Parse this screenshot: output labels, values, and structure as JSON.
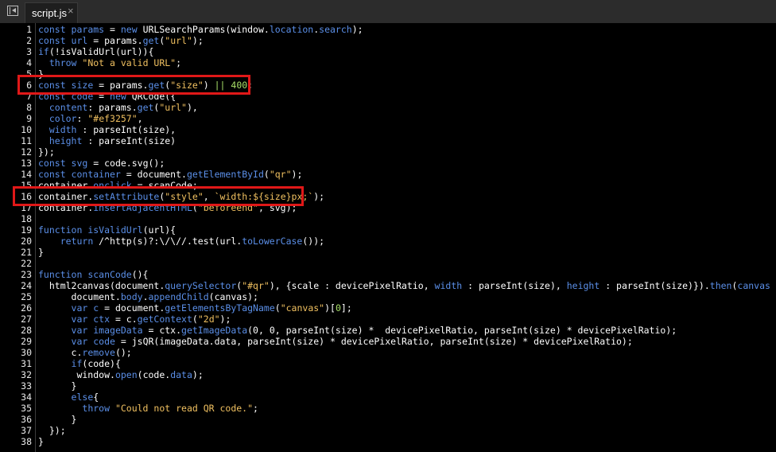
{
  "tab": {
    "label": "script.js",
    "close": "×"
  },
  "lines": [
    {
      "n": "1",
      "tokens": [
        [
          "kw",
          "const "
        ],
        [
          "id",
          "params"
        ],
        [
          "tx",
          " = "
        ],
        [
          "kw",
          "new "
        ],
        [
          "tx",
          "URLSearchParams(window."
        ],
        [
          "id",
          "location"
        ],
        [
          "tx",
          "."
        ],
        [
          "id",
          "search"
        ],
        [
          "tx",
          ");"
        ]
      ]
    },
    {
      "n": "2",
      "tokens": [
        [
          "kw",
          "const "
        ],
        [
          "id",
          "url"
        ],
        [
          "tx",
          " = params."
        ],
        [
          "id",
          "get"
        ],
        [
          "tx",
          "("
        ],
        [
          "str",
          "\"url\""
        ],
        [
          "tx",
          ");"
        ]
      ]
    },
    {
      "n": "3",
      "tokens": [
        [
          "kw",
          "if"
        ],
        [
          "tx",
          "(!isValidUrl(url)){"
        ]
      ]
    },
    {
      "n": "4",
      "tokens": [
        [
          "tx",
          "  "
        ],
        [
          "kw",
          "throw "
        ],
        [
          "str",
          "\"Not a valid URL\""
        ],
        [
          "tx",
          ";"
        ]
      ]
    },
    {
      "n": "5",
      "tokens": [
        [
          "tx",
          "}"
        ]
      ]
    },
    {
      "n": "6",
      "tokens": [
        [
          "kw",
          "const "
        ],
        [
          "id",
          "size"
        ],
        [
          "tx",
          " = params."
        ],
        [
          "id",
          "get"
        ],
        [
          "tx",
          "("
        ],
        [
          "str",
          "\"size\""
        ],
        [
          "tx",
          ") "
        ],
        [
          "num",
          "|| 400"
        ],
        [
          "tx",
          ";"
        ]
      ]
    },
    {
      "n": "7",
      "tokens": [
        [
          "kw",
          "const "
        ],
        [
          "id",
          "code"
        ],
        [
          "tx",
          " = "
        ],
        [
          "kw",
          "new "
        ],
        [
          "tx",
          "QRCode({"
        ]
      ]
    },
    {
      "n": "8",
      "tokens": [
        [
          "tx",
          "  "
        ],
        [
          "id",
          "content"
        ],
        [
          "tx",
          ": params."
        ],
        [
          "id",
          "get"
        ],
        [
          "tx",
          "("
        ],
        [
          "str",
          "\"url\""
        ],
        [
          "tx",
          "),"
        ]
      ]
    },
    {
      "n": "9",
      "tokens": [
        [
          "tx",
          "  "
        ],
        [
          "id",
          "color"
        ],
        [
          "tx",
          ": "
        ],
        [
          "str",
          "\"#ef3257\""
        ],
        [
          "tx",
          ","
        ]
      ]
    },
    {
      "n": "10",
      "tokens": [
        [
          "tx",
          "  "
        ],
        [
          "id",
          "width"
        ],
        [
          "tx",
          " : parseInt(size),"
        ]
      ]
    },
    {
      "n": "11",
      "tokens": [
        [
          "tx",
          "  "
        ],
        [
          "id",
          "height"
        ],
        [
          "tx",
          " : parseInt(size)"
        ]
      ]
    },
    {
      "n": "12",
      "tokens": [
        [
          "tx",
          "});"
        ]
      ]
    },
    {
      "n": "13",
      "tokens": [
        [
          "kw",
          "const "
        ],
        [
          "id",
          "svg"
        ],
        [
          "tx",
          " = code.svg();"
        ]
      ]
    },
    {
      "n": "14",
      "tokens": [
        [
          "kw",
          "const "
        ],
        [
          "id",
          "container"
        ],
        [
          "tx",
          " = document."
        ],
        [
          "id",
          "getElementById"
        ],
        [
          "tx",
          "("
        ],
        [
          "str",
          "\"qr\""
        ],
        [
          "tx",
          ");"
        ]
      ]
    },
    {
      "n": "15",
      "tokens": [
        [
          "tx",
          "container."
        ],
        [
          "id",
          "onclick"
        ],
        [
          "tx",
          " = scanCode;"
        ]
      ]
    },
    {
      "n": "16",
      "tokens": [
        [
          "tx",
          "container."
        ],
        [
          "id",
          "setAttribute"
        ],
        [
          "tx",
          "("
        ],
        [
          "str",
          "\"style\""
        ],
        [
          "tx",
          ", "
        ],
        [
          "str",
          "`width:${size}px;`"
        ],
        [
          "tx",
          ");"
        ]
      ]
    },
    {
      "n": "17",
      "tokens": [
        [
          "tx",
          "container."
        ],
        [
          "id",
          "insertAdjacentHTML"
        ],
        [
          "tx",
          "("
        ],
        [
          "str",
          "\"beforeend\""
        ],
        [
          "tx",
          ", svg);"
        ]
      ]
    },
    {
      "n": "18",
      "tokens": []
    },
    {
      "n": "19",
      "tokens": [
        [
          "kw",
          "function "
        ],
        [
          "id",
          "isValidUrl"
        ],
        [
          "tx",
          "(url){"
        ]
      ]
    },
    {
      "n": "20",
      "tokens": [
        [
          "tx",
          "    "
        ],
        [
          "kw",
          "return "
        ],
        [
          "tx",
          "/^http(s)?:\\/\\//.test(url."
        ],
        [
          "id",
          "toLowerCase"
        ],
        [
          "tx",
          "());"
        ]
      ]
    },
    {
      "n": "21",
      "tokens": [
        [
          "tx",
          "}"
        ]
      ]
    },
    {
      "n": "22",
      "tokens": []
    },
    {
      "n": "23",
      "tokens": [
        [
          "kw",
          "function "
        ],
        [
          "id",
          "scanCode"
        ],
        [
          "tx",
          "(){"
        ]
      ]
    },
    {
      "n": "24",
      "tokens": [
        [
          "tx",
          "  html2canvas(document."
        ],
        [
          "id",
          "querySelector"
        ],
        [
          "tx",
          "("
        ],
        [
          "str",
          "\"#qr\""
        ],
        [
          "tx",
          "), {scale : devicePixelRatio, "
        ],
        [
          "id",
          "width"
        ],
        [
          "tx",
          " : parseInt(size), "
        ],
        [
          "id",
          "height"
        ],
        [
          "tx",
          " : parseInt(size)})."
        ],
        [
          "id",
          "then"
        ],
        [
          "tx",
          "("
        ],
        [
          "id",
          "canvas"
        ],
        [
          "kw",
          " => "
        ],
        [
          "tx",
          "{"
        ]
      ]
    },
    {
      "n": "25",
      "tokens": [
        [
          "tx",
          "      document."
        ],
        [
          "id",
          "body"
        ],
        [
          "tx",
          "."
        ],
        [
          "id",
          "appendChild"
        ],
        [
          "tx",
          "(canvas);"
        ]
      ]
    },
    {
      "n": "26",
      "tokens": [
        [
          "tx",
          "      "
        ],
        [
          "kw",
          "var "
        ],
        [
          "id",
          "c"
        ],
        [
          "tx",
          " = document."
        ],
        [
          "id",
          "getElementsByTagName"
        ],
        [
          "tx",
          "("
        ],
        [
          "str",
          "\"canvas\""
        ],
        [
          "tx",
          ")["
        ],
        [
          "num",
          "0"
        ],
        [
          "tx",
          "];"
        ]
      ]
    },
    {
      "n": "27",
      "tokens": [
        [
          "tx",
          "      "
        ],
        [
          "kw",
          "var "
        ],
        [
          "id",
          "ctx"
        ],
        [
          "tx",
          " = c."
        ],
        [
          "id",
          "getContext"
        ],
        [
          "tx",
          "("
        ],
        [
          "str",
          "\"2d\""
        ],
        [
          "tx",
          ");"
        ]
      ]
    },
    {
      "n": "28",
      "tokens": [
        [
          "tx",
          "      "
        ],
        [
          "kw",
          "var "
        ],
        [
          "id",
          "imageData"
        ],
        [
          "tx",
          " = ctx."
        ],
        [
          "id",
          "getImageData"
        ],
        [
          "tx",
          "(0, 0, parseInt(size) *  devicePixelRatio, parseInt(size) * devicePixelRatio);"
        ]
      ]
    },
    {
      "n": "29",
      "tokens": [
        [
          "tx",
          "      "
        ],
        [
          "kw",
          "var "
        ],
        [
          "id",
          "code"
        ],
        [
          "tx",
          " = jsQR(imageData.data, parseInt(size) * devicePixelRatio, parseInt(size) * devicePixelRatio);"
        ]
      ]
    },
    {
      "n": "30",
      "tokens": [
        [
          "tx",
          "      c."
        ],
        [
          "id",
          "remove"
        ],
        [
          "tx",
          "();"
        ]
      ]
    },
    {
      "n": "31",
      "tokens": [
        [
          "tx",
          "      "
        ],
        [
          "kw",
          "if"
        ],
        [
          "tx",
          "(code){"
        ]
      ]
    },
    {
      "n": "32",
      "tokens": [
        [
          "tx",
          "       window."
        ],
        [
          "id",
          "open"
        ],
        [
          "tx",
          "(code."
        ],
        [
          "id",
          "data"
        ],
        [
          "tx",
          ");"
        ]
      ]
    },
    {
      "n": "33",
      "tokens": [
        [
          "tx",
          "      }"
        ]
      ]
    },
    {
      "n": "34",
      "tokens": [
        [
          "tx",
          "      "
        ],
        [
          "kw",
          "else"
        ],
        [
          "tx",
          "{"
        ]
      ]
    },
    {
      "n": "35",
      "tokens": [
        [
          "tx",
          "        "
        ],
        [
          "kw",
          "throw "
        ],
        [
          "str",
          "\"Could not read QR code.\""
        ],
        [
          "tx",
          ";"
        ]
      ]
    },
    {
      "n": "36",
      "tokens": [
        [
          "tx",
          "      }"
        ]
      ]
    },
    {
      "n": "37",
      "tokens": [
        [
          "tx",
          "  });"
        ]
      ]
    },
    {
      "n": "38",
      "tokens": [
        [
          "tx",
          "}"
        ]
      ]
    }
  ],
  "highlights": [
    {
      "line": "6",
      "color": "#e01818"
    },
    {
      "line": "16",
      "color": "#e01818"
    }
  ],
  "colors": {
    "keyword": "#5b8fe8",
    "string": "#f0c060",
    "number": "#a8e068",
    "text": "#ffffff",
    "editor_bg": "#000000",
    "highlight_border": "#e01818"
  }
}
